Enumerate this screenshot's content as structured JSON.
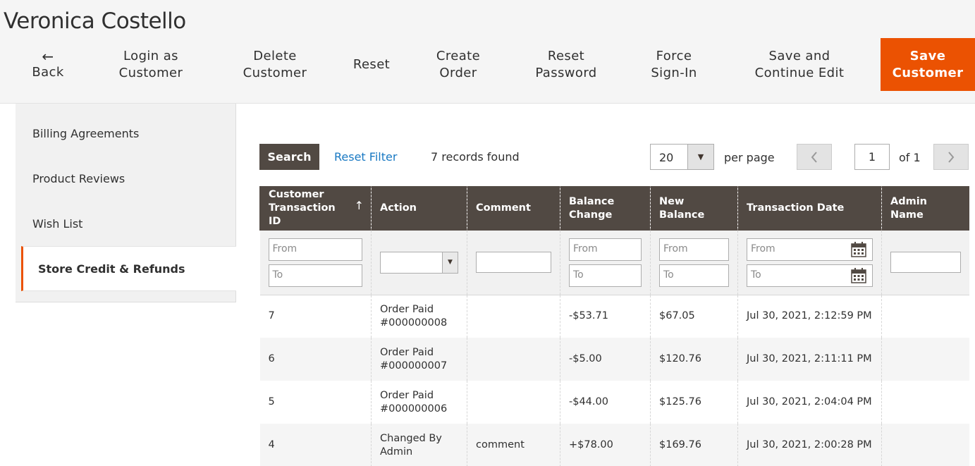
{
  "page": {
    "title": "Veronica Costello"
  },
  "actions": {
    "back": {
      "arrow": "←",
      "label": "Back"
    },
    "login_as_customer": [
      "Login as",
      "Customer"
    ],
    "delete_customer": [
      "Delete",
      "Customer"
    ],
    "reset": "Reset",
    "create_order": [
      "Create",
      "Order"
    ],
    "reset_password": [
      "Reset",
      "Password"
    ],
    "force_sign_in": [
      "Force",
      "Sign-In"
    ],
    "save_and_continue": [
      "Save and",
      "Continue Edit"
    ],
    "save_customer": [
      "Save",
      "Customer"
    ],
    "primary_color": "#eb5202"
  },
  "sidebar": {
    "items": [
      {
        "label": "Billing Agreements"
      },
      {
        "label": "Product Reviews"
      },
      {
        "label": "Wish List"
      },
      {
        "label": "Store Credit & Refunds",
        "active": true
      }
    ]
  },
  "grid_header": {
    "search_label": "Search",
    "reset_filter_label": "Reset Filter",
    "records_found": "7 records found",
    "per_page_value": "20",
    "per_page_label": "per page",
    "current_page": "1",
    "of_pages": "of 1",
    "prev_icon": "chevron-left-icon",
    "next_icon": "chevron-right-icon"
  },
  "table": {
    "columns": [
      "Customer Transaction ID",
      "Action",
      "Comment",
      "Balance Change",
      "New Balance",
      "Transaction Date",
      "Admin Name"
    ],
    "sort_indicator": "↑",
    "filters": {
      "from_placeholder": "From",
      "to_placeholder": "To"
    },
    "rows": [
      {
        "id": "7",
        "action": [
          "Order Paid",
          "#000000008"
        ],
        "comment": "",
        "balance_change": "-$53.71",
        "change_type": "neg",
        "new_balance": "$67.05",
        "date": "Jul 30, 2021, 2:12:59 PM",
        "admin": ""
      },
      {
        "id": "6",
        "action": [
          "Order Paid",
          "#000000007"
        ],
        "comment": "",
        "balance_change": "-$5.00",
        "change_type": "neg",
        "new_balance": "$120.76",
        "date": "Jul 30, 2021, 2:11:11 PM",
        "admin": ""
      },
      {
        "id": "5",
        "action": [
          "Order Paid",
          "#000000006"
        ],
        "comment": "",
        "balance_change": "-$44.00",
        "change_type": "neg",
        "new_balance": "$125.76",
        "date": "Jul 30, 2021, 2:04:04 PM",
        "admin": ""
      },
      {
        "id": "4",
        "action": [
          "Changed By",
          "Admin"
        ],
        "comment": "comment",
        "balance_change": "+$78.00",
        "change_type": "pos",
        "new_balance": "$169.76",
        "date": "Jul 30, 2021, 2:00:28 PM",
        "admin": ""
      }
    ],
    "negative_color": "#e22626",
    "positive_color": "#185b00"
  }
}
